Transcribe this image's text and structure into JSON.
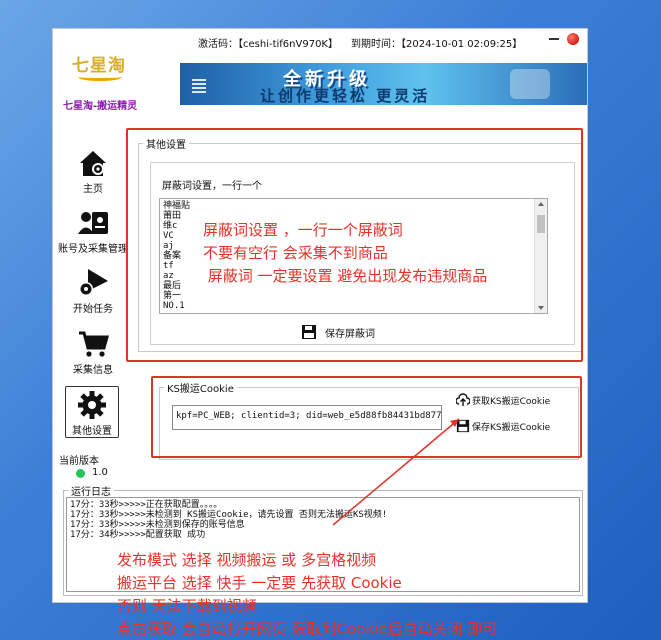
{
  "topbar": {
    "activation": "激活码：【ceshi-tif6nV970K】",
    "expiry": "到期时间：【2024-10-01 02:09:25】"
  },
  "logo": {
    "text": "七星淘"
  },
  "app_name": "七星淘-搬运精灵",
  "banner": {
    "main": "全新升级",
    "sub": "让创作更轻松 更灵活"
  },
  "sidebar": {
    "items": [
      {
        "label": "主页",
        "icon": "home-gear-icon"
      },
      {
        "label": "账号及采集管理",
        "icon": "account-card-icon"
      },
      {
        "label": "开始任务",
        "icon": "play-gear-icon"
      },
      {
        "label": "采集信息",
        "icon": "cart-icon"
      },
      {
        "label": "其他设置",
        "icon": "gear-icon"
      }
    ],
    "version_title": "当前版本",
    "version_value": "1.0",
    "version_dot_color": "#22c55e"
  },
  "settings": {
    "group_title": "其他设置",
    "block_label": "屏蔽词设置，一行一个",
    "blocked_words": [
      "神福贴",
      "莆田",
      "维c",
      "VC",
      "aj",
      "备案",
      "tf",
      "az",
      "最后",
      "第一",
      "NO.1"
    ],
    "save_label": "保存屏蔽词"
  },
  "ks": {
    "group_title": "KS搬运Cookie",
    "cookie_value": "kpf=PC_WEB; clientid=3; did=web_e5d88fb84431bd8778e6c",
    "get_label": "获取KS搬运Cookie",
    "save_label": "保存KS搬运Cookie"
  },
  "log": {
    "title": "运行日志",
    "lines": [
      "17分：33秒>>>>>正在获取配置。。。。",
      "17分：33秒>>>>>未检测到 KS搬运Cookie，请先设置 否则无法搬运KS视频!",
      "17分：33秒>>>>>未检测到保存的账号信息",
      "17分：34秒>>>>>配置获取 成功"
    ]
  },
  "annotations": {
    "settings_note": [
      "屏蔽词设置 ，一行一个屏蔽词",
      "不要有空行 会采集不到商品",
      " 屏蔽词 一定要设置 避免出现发布违规商品"
    ],
    "bottom_note": [
      "发布模式 选择 视频搬运  或 多宫格视频",
      "搬运平台 选择 快手   一定要 先获取 Cookie",
      "否则 无法下载到视频",
      "点击获取 会自动打开网页 获取到Cookie后自动关闭 即可"
    ]
  },
  "colors": {
    "annotation_red": "#e6332a",
    "brand_purple": "#8b1fb0",
    "logo_gold": "#d7ae2f"
  }
}
